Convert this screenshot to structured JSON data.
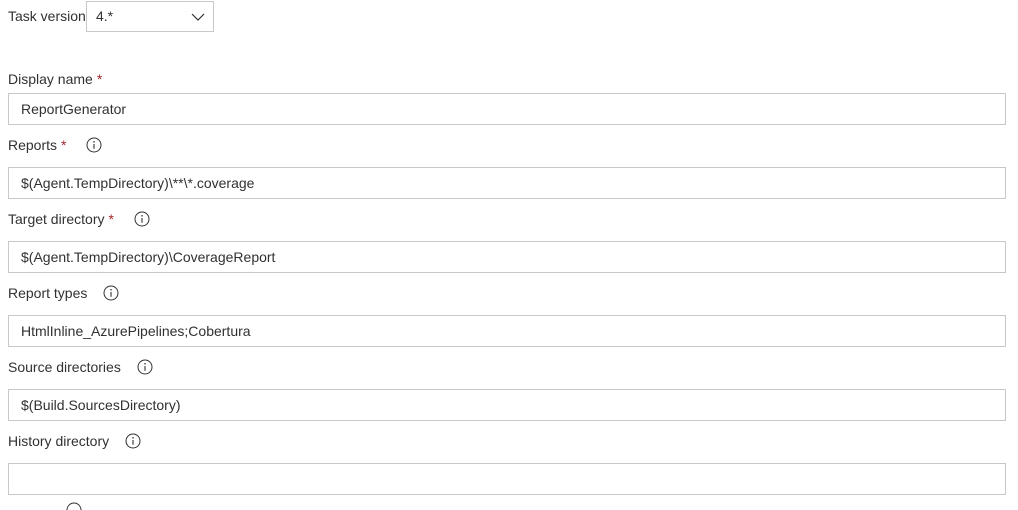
{
  "task_version": {
    "label": "Task version",
    "value": "4.*"
  },
  "fields": {
    "display_name": {
      "label": "Display name",
      "required_mark": "*",
      "value": "ReportGenerator"
    },
    "reports": {
      "label": "Reports",
      "required_mark": "*",
      "value": "$(Agent.TempDirectory)\\**\\*.coverage"
    },
    "target_directory": {
      "label": "Target directory",
      "required_mark": "*",
      "value": "$(Agent.TempDirectory)\\CoverageReport"
    },
    "report_types": {
      "label": "Report types",
      "value": "HtmlInline_AzurePipelines;Cobertura"
    },
    "source_directories": {
      "label": "Source directories",
      "value": "$(Build.SourcesDirectory)"
    },
    "history_directory": {
      "label": "History directory",
      "value": ""
    }
  },
  "icons": {
    "info": "info-icon",
    "dropdown": "chevron-down-icon"
  },
  "colors": {
    "required": "#a4262c",
    "border": "#c8c8c8",
    "text": "#323130"
  }
}
